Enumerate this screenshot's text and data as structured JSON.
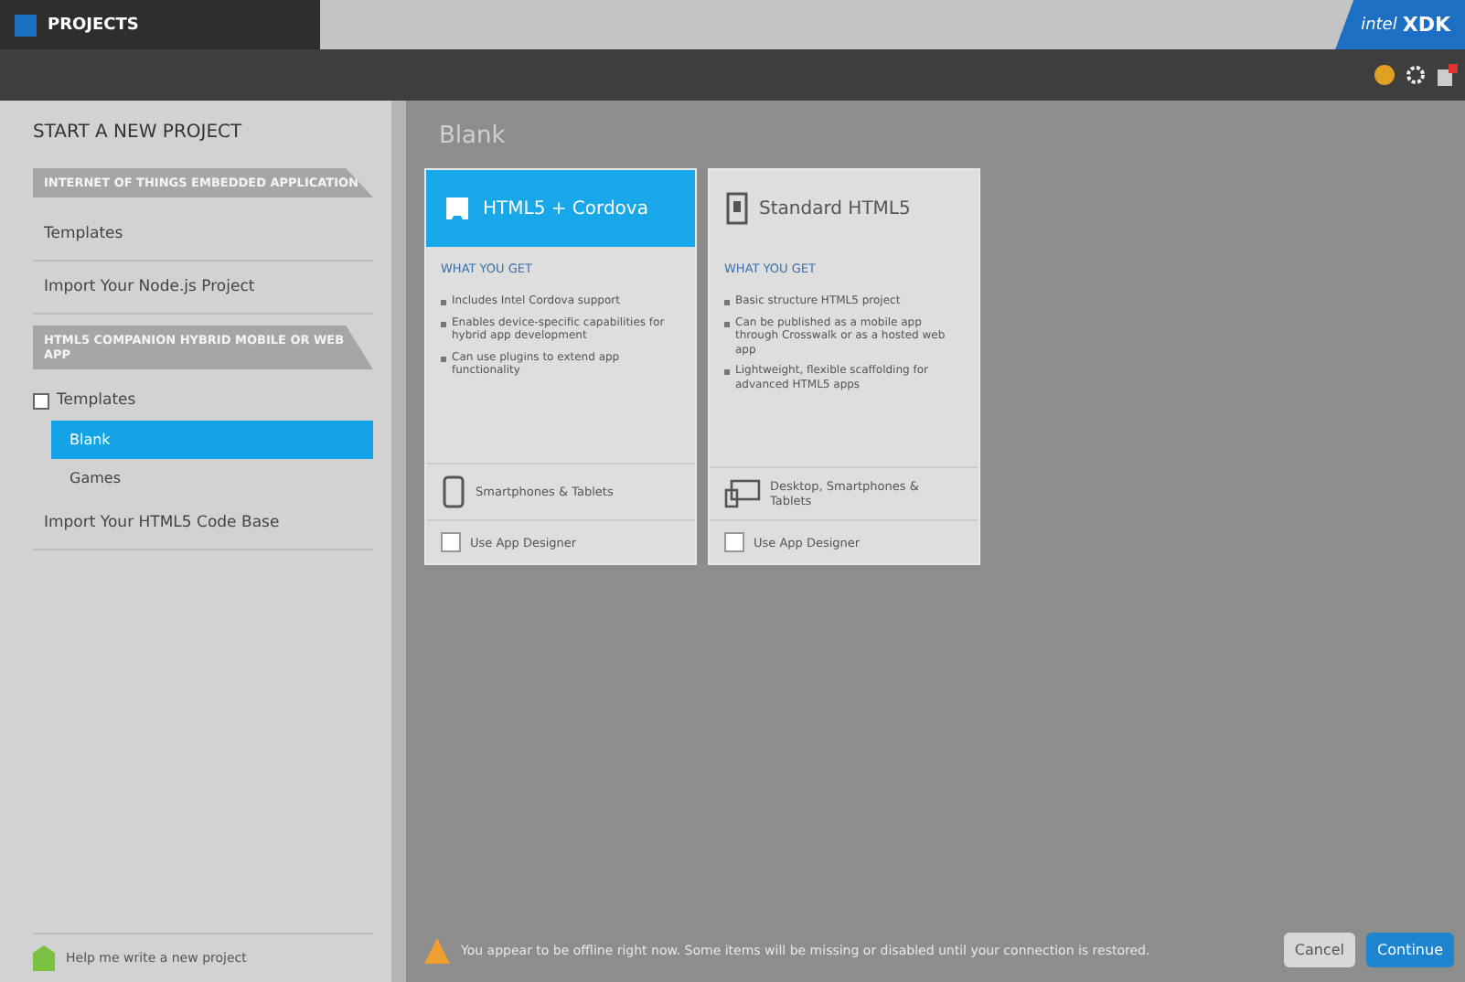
{
  "tab": {
    "label": "PROJECTS"
  },
  "logo": {
    "brand": "intel",
    "product": "XDK"
  },
  "sidebar": {
    "title": "START A NEW PROJECT",
    "sections": [
      {
        "heading": "INTERNET OF THINGS EMBEDDED APPLICATION",
        "items": [
          {
            "label": "Templates",
            "kind": "link"
          },
          {
            "label": "Import Your Node.js Project",
            "kind": "link"
          }
        ]
      },
      {
        "heading": "HTML5 COMPANION HYBRID MOBILE OR WEB APP",
        "items": [
          {
            "label": "Templates",
            "kind": "group",
            "expanded": true,
            "children": [
              {
                "label": "Blank",
                "selected": true
              },
              {
                "label": "Games",
                "selected": false
              }
            ]
          },
          {
            "label": "Import Your HTML5 Code Base",
            "kind": "link"
          }
        ]
      }
    ],
    "footer": "Help me write a new project"
  },
  "main": {
    "title": "Blank",
    "cards": [
      {
        "title": "HTML5 + Cordova",
        "selected": true,
        "subtitle": "WHAT YOU GET",
        "bullets": [
          "Includes Intel Cordova support",
          "Enables device-specific capabilities for hybrid app development",
          "Can use plugins to extend app functionality"
        ],
        "target": "Smartphones & Tablets",
        "designer": {
          "label": "Use App Designer",
          "checked": false
        }
      },
      {
        "title": "Standard HTML5",
        "selected": false,
        "subtitle": "WHAT YOU GET",
        "bullets": [
          "Basic structure HTML5 project",
          "Can be published as a mobile app through Crosswalk or as a hosted web app",
          "Lightweight, flexible scaffolding for advanced HTML5 apps"
        ],
        "target": "Desktop, Smartphones & Tablets",
        "designer": {
          "label": "Use App Designer",
          "checked": false
        }
      }
    ]
  },
  "status": {
    "message": "You appear to be offline right now. Some items will be missing or disabled until your connection is restored."
  },
  "buttons": [
    {
      "label": "Cancel",
      "kind": "secondary"
    },
    {
      "label": "Continue",
      "kind": "primary"
    }
  ]
}
